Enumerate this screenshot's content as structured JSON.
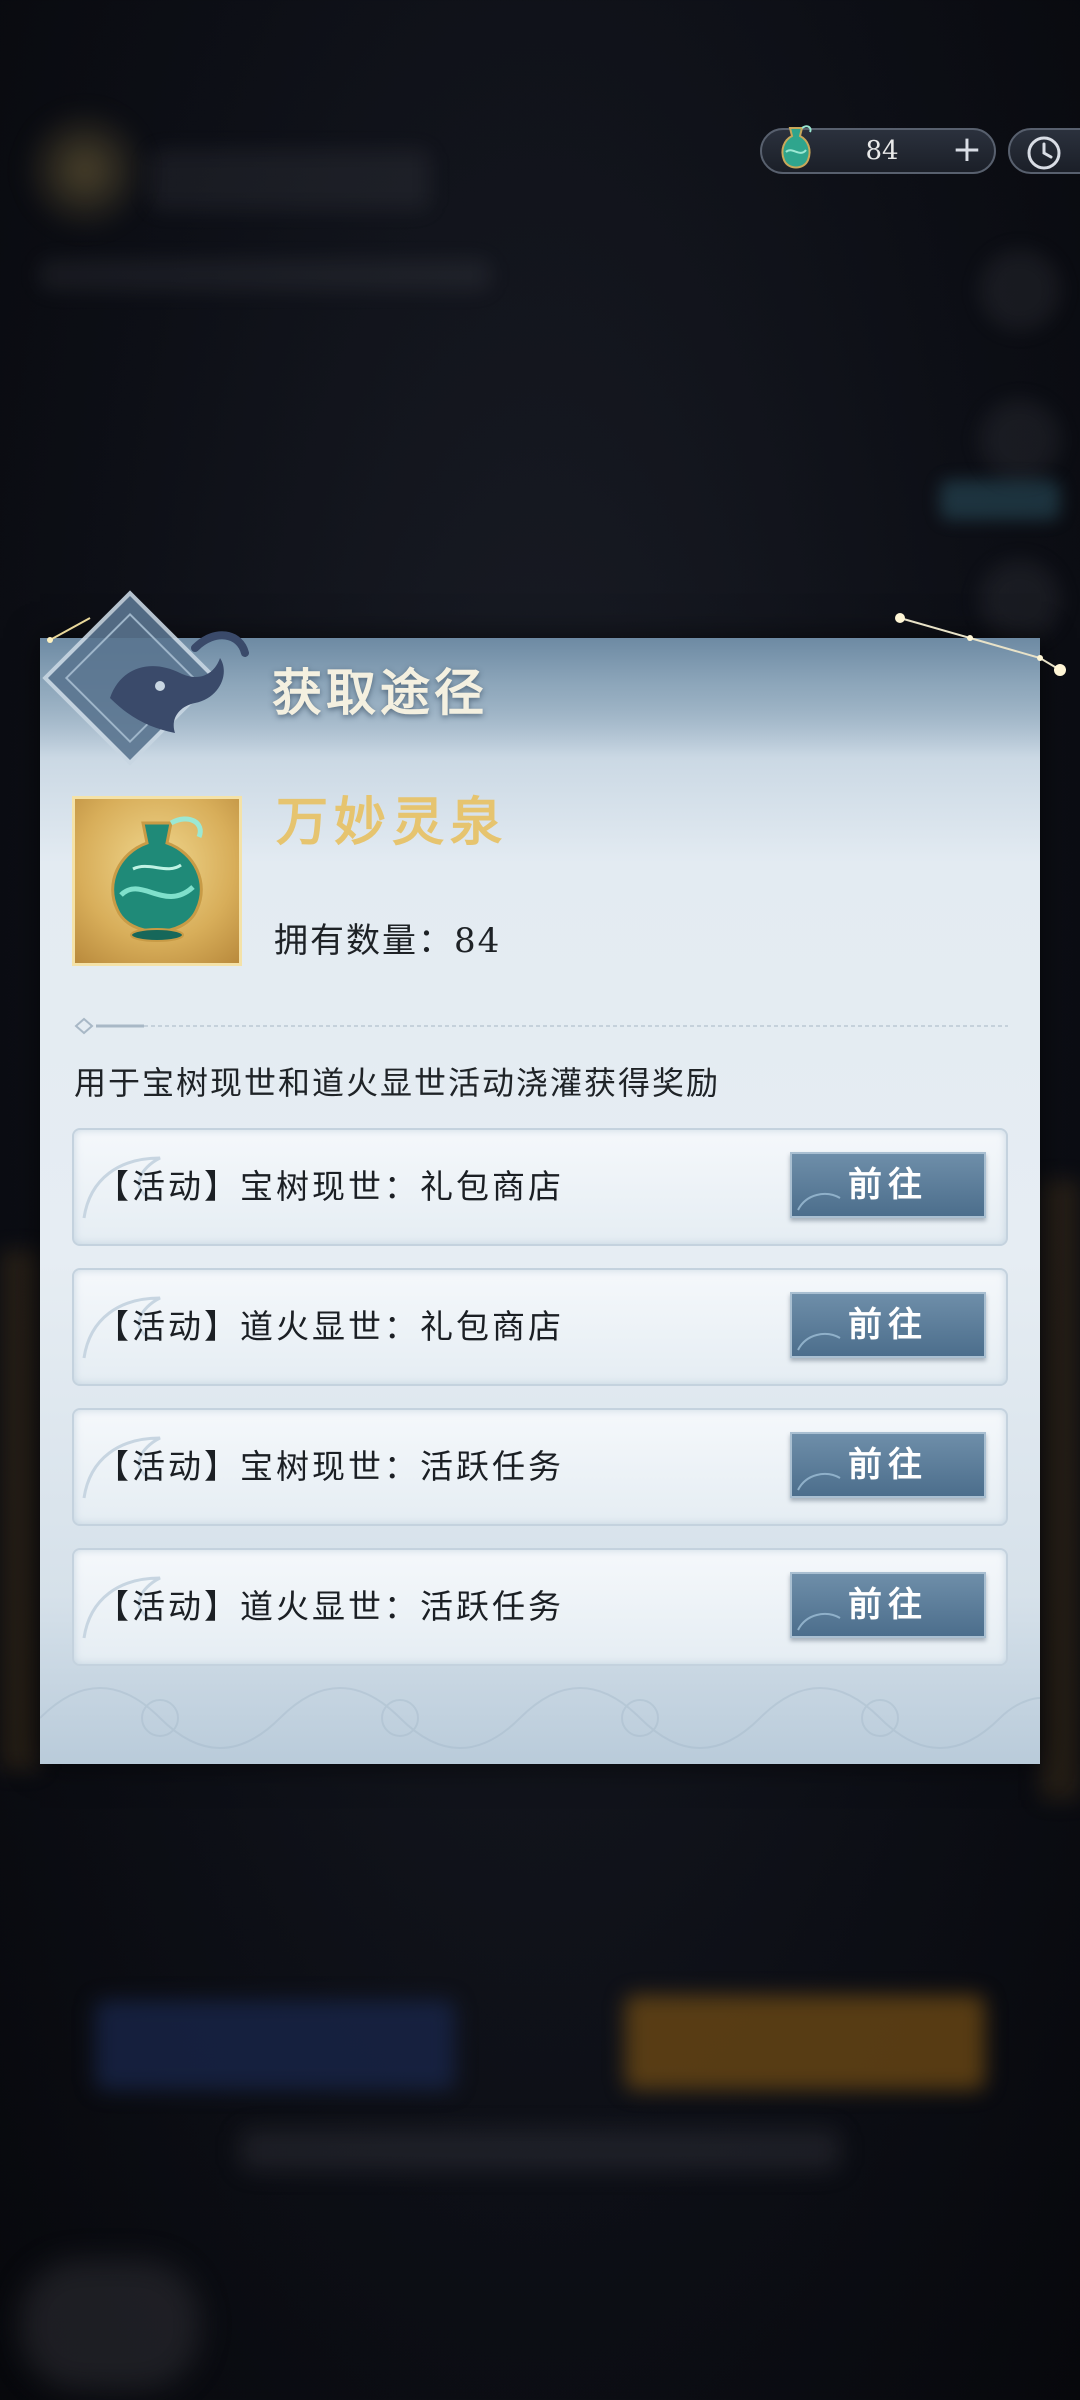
{
  "currency": {
    "amount": "84",
    "plus": "+"
  },
  "dialog": {
    "title": "获取途径",
    "item": {
      "name": "万妙灵泉",
      "count_label": "拥有数量：84"
    },
    "description": "用于宝树现世和道火显世活动浇灌获得奖励",
    "routes": [
      {
        "label": "【活动】宝树现世：礼包商店",
        "button": "前往"
      },
      {
        "label": "【活动】道火显世：礼包商店",
        "button": "前往"
      },
      {
        "label": "【活动】宝树现世：活跃任务",
        "button": "前往"
      },
      {
        "label": "【活动】道火显世：活跃任务",
        "button": "前往"
      }
    ]
  },
  "colors": {
    "item_name": "#e6c46f",
    "button_bg": "#5a7b97",
    "dialog_bg": "#e3ebf2"
  },
  "icons": {
    "currency": "green-vase-icon",
    "clock": "clock-icon",
    "item": "spirit-spring-vase-icon"
  }
}
